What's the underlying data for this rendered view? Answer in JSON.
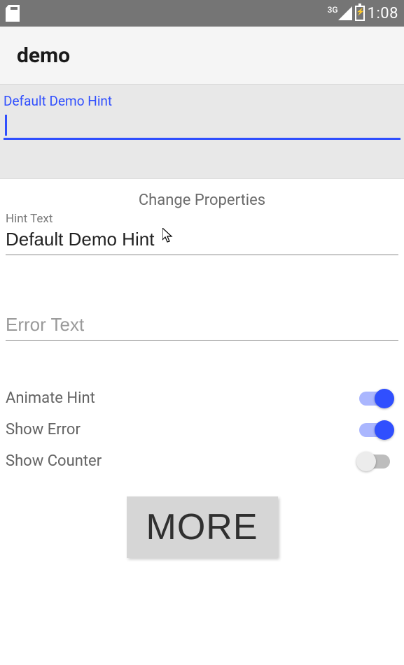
{
  "status": {
    "network": "3G",
    "time": "1:08"
  },
  "appbar": {
    "title": "demo"
  },
  "demoField": {
    "floatLabel": "Default Demo Hint",
    "value": ""
  },
  "properties": {
    "sectionTitle": "Change Properties",
    "hintText": {
      "label": "Hint Text",
      "value": "Default Demo Hint"
    },
    "errorText": {
      "placeholder": "Error Text",
      "value": ""
    }
  },
  "switches": {
    "animateHint": {
      "label": "Animate Hint",
      "value": true
    },
    "showError": {
      "label": "Show Error",
      "value": true
    },
    "showCounter": {
      "label": "Show Counter",
      "value": false
    }
  },
  "moreButton": {
    "label": "MORE"
  }
}
